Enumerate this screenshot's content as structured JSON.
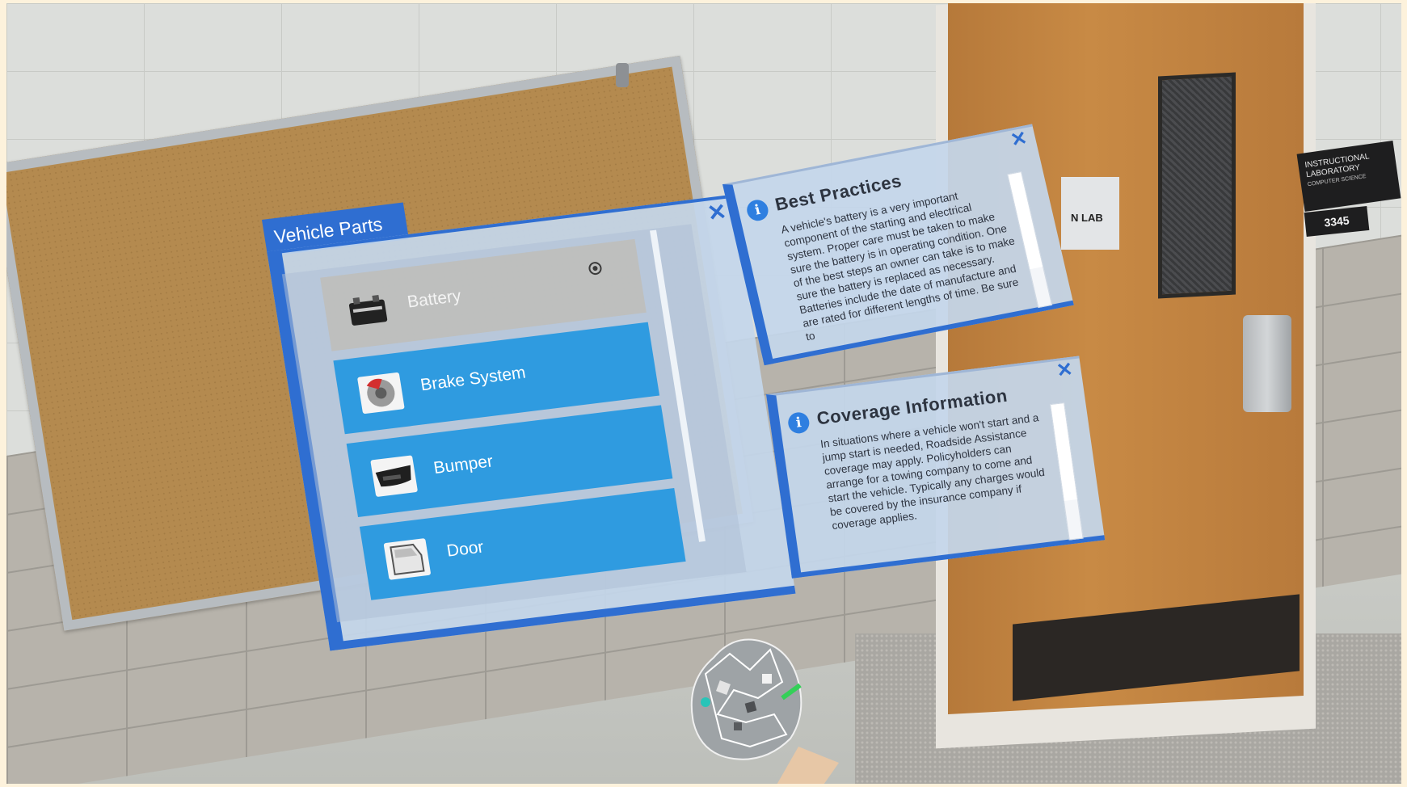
{
  "vehicle_parts": {
    "title": "Vehicle Parts",
    "close_label": "✕",
    "items": [
      {
        "label": "Battery",
        "icon": "battery-icon",
        "selected": true
      },
      {
        "label": "Brake System",
        "icon": "brake-disc-icon",
        "selected": false
      },
      {
        "label": "Bumper",
        "icon": "bumper-icon",
        "selected": false
      },
      {
        "label": "Door",
        "icon": "car-door-icon",
        "selected": false
      }
    ]
  },
  "best_practices": {
    "title": "Best Practices",
    "info_glyph": "i",
    "close_label": "✕",
    "body": "A vehicle's battery is a very important component of the starting and electrical system. Proper care must be taken to make sure the battery is in operating condition. One of the best steps an owner can take is to make sure the battery is replaced as necessary. Batteries include the date of manufacture and are rated for different lengths of time. Be sure to"
  },
  "coverage_info": {
    "title": "Coverage Information",
    "info_glyph": "i",
    "close_label": "✕",
    "body": "In situations where a vehicle won't start and a jump start is needed, Roadside Assistance coverage may apply. Policyholders can arrange for a towing company to come and start the vehicle. Typically any charges would be covered by the insurance company if coverage applies."
  },
  "environment": {
    "door_sign_text": "N LAB",
    "room_sign_line1": "INSTRUCTIONAL LABORATORY",
    "room_sign_line2": "COMPUTER SCIENCE",
    "room_number": "3345"
  },
  "colors": {
    "panel_accent": "#2f6ed1",
    "list_item": "#2f9be0",
    "panel_fill": "#c4d6eb"
  }
}
